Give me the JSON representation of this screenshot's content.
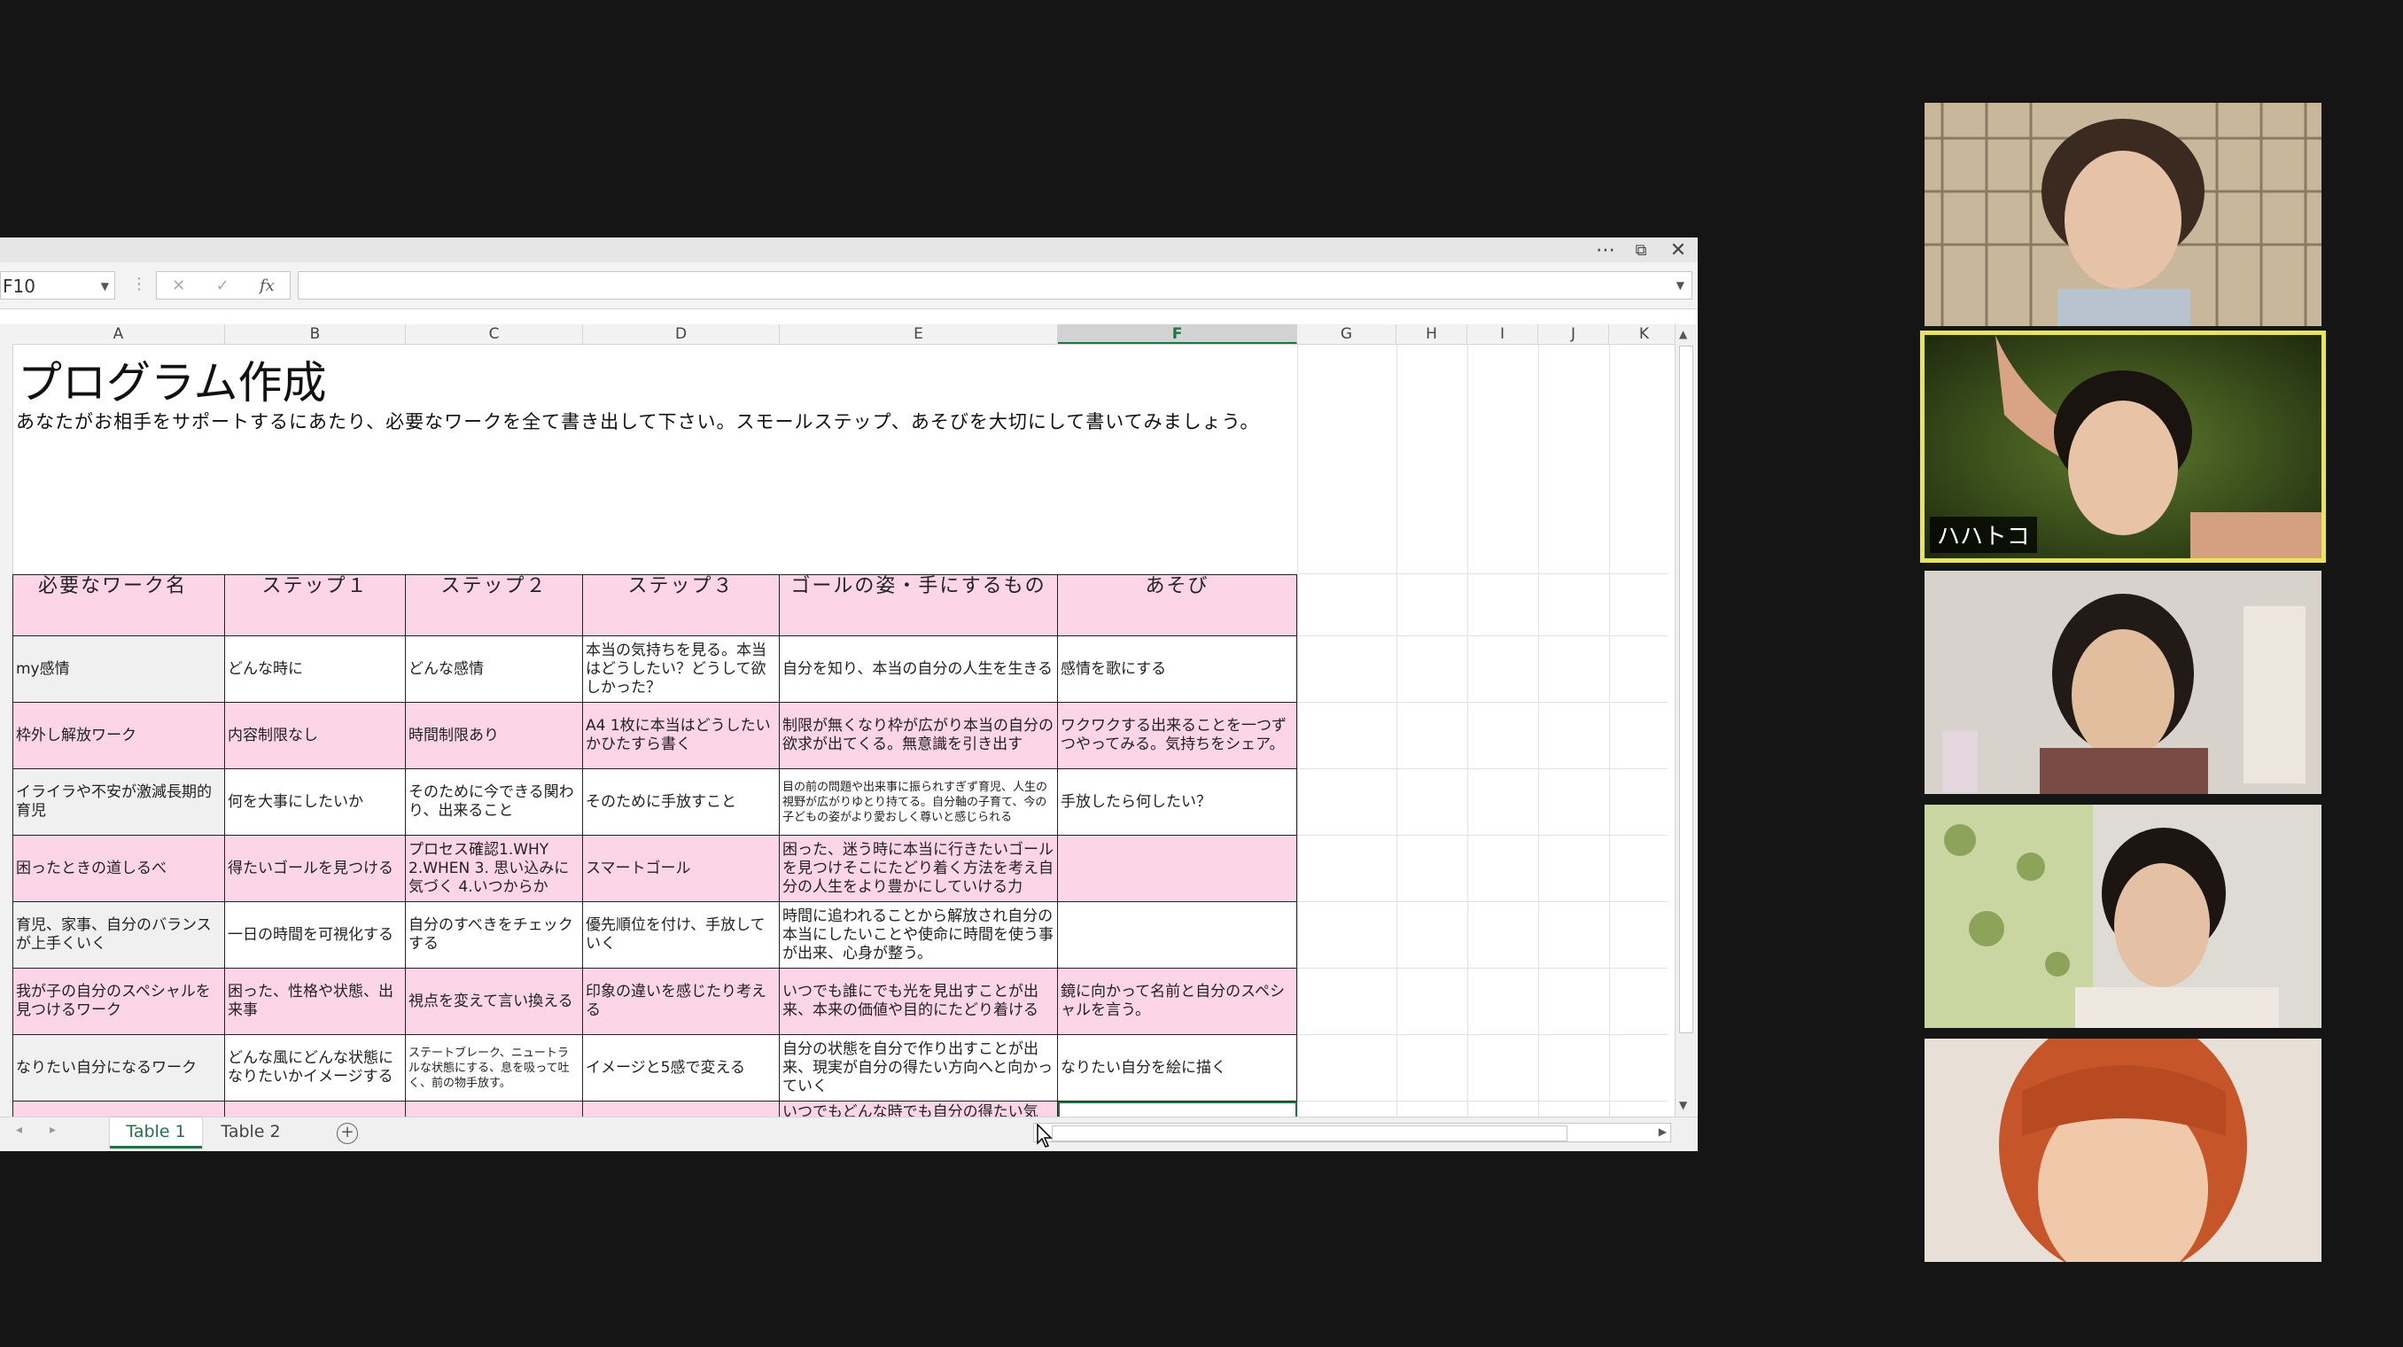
{
  "window": {
    "more_icon": "ellipsis-icon",
    "restore_icon": "restore-icon",
    "close_icon": "close-icon"
  },
  "formula_bar": {
    "name_box": "F10",
    "formula": ""
  },
  "columns": [
    "A",
    "B",
    "C",
    "D",
    "E",
    "F",
    "G",
    "H",
    "I",
    "J",
    "K"
  ],
  "selected_column": "F",
  "sheet": {
    "title": "プログラム作成",
    "subtitle": "あなたがお相手をサポートするにあたり、必要なワークを全て書き出して下さい。スモールステップ、あそびを大切にして書いてみましょう。",
    "headers": [
      "必要なワーク名",
      "ステップ１",
      "ステップ２",
      "ステップ３",
      "ゴールの姿・手にするもの",
      "あそび"
    ],
    "rows": [
      [
        "my感情",
        "どんな時に",
        "どんな感情",
        "本当の気持ちを見る。本当はどうしたい？どうして欲しかった？",
        "自分を知り、本当の自分の人生を生きる",
        "感情を歌にする"
      ],
      [
        "枠外し解放ワーク",
        "内容制限なし",
        "時間制限あり",
        "A4 1枚に本当はどうしたいかひたすら書く",
        "制限が無くなり枠が広がり本当の自分の欲求が出てくる。無意識を引き出す",
        "ワクワクする出来ることを一つずつやってみる。気持ちをシェア。"
      ],
      [
        "イライラや不安が激減長期的育児",
        "何を大事にしたいか",
        "そのために今できる関わり、出来ること",
        "そのために手放すこと",
        "目の前の問題や出来事に振られすぎず育児、人生の視野が広がりゆとり持てる。自分軸の子育て、今の子どもの姿がより愛おしく尊いと感じられる",
        "手放したら何したい？"
      ],
      [
        "困ったときの道しるべ",
        "得たいゴールを見つける",
        "プロセス確認1.WHY 2.WHEN 3. 思い込みに気づく 4.いつからか",
        "スマートゴール",
        "困った、迷う時に本当に行きたいゴールを見つけそこにたどり着く方法を考え自分の人生をより豊かにしていける力",
        ""
      ],
      [
        "育児、家事、自分のバランスが上手くいく",
        "一日の時間を可視化する",
        "自分のすべきをチェックする",
        "優先順位を付け、手放していく",
        "時間に追われることから解放され自分の本当にしたいことや使命に時間を使う事が出来、心身が整う。",
        ""
      ],
      [
        "我が子の自分のスペシャルを見つけるワーク",
        "困った、性格や状態、出来事",
        "視点を変えて言い換える",
        "印象の違いを感じたり考える",
        "いつでも誰にでも光を見出すことが出来、本来の価値や目的にたどり着ける",
        "鏡に向かって名前と自分のスペシャルを言う。"
      ],
      [
        "なりたい自分になるワーク",
        "どんな風にどんな状態になりたいかイメージする",
        "ステートブレーク、ニュートラルな状態にする、息を吸って吐く、前の物手放す。",
        "イメージと5感で変える",
        "自分の状態を自分で作り出すことが出来、現実が自分の得たい方向へと向かっていく",
        "なりたい自分を絵に描く"
      ]
    ],
    "partial_row": "いつでもどんな時でも自分の得たい気"
  },
  "tabs": [
    {
      "label": "Table 1",
      "active": true
    },
    {
      "label": "Table 2",
      "active": false
    }
  ],
  "participants": [
    {
      "name": ""
    },
    {
      "name": "ハハトコ",
      "active": true
    },
    {
      "name": ""
    },
    {
      "name": ""
    },
    {
      "name": ""
    }
  ],
  "colors": {
    "header_pink": "#fcd5e6",
    "excel_green": "#217346",
    "active_speaker": "#e8e55c",
    "background": "#151515"
  }
}
